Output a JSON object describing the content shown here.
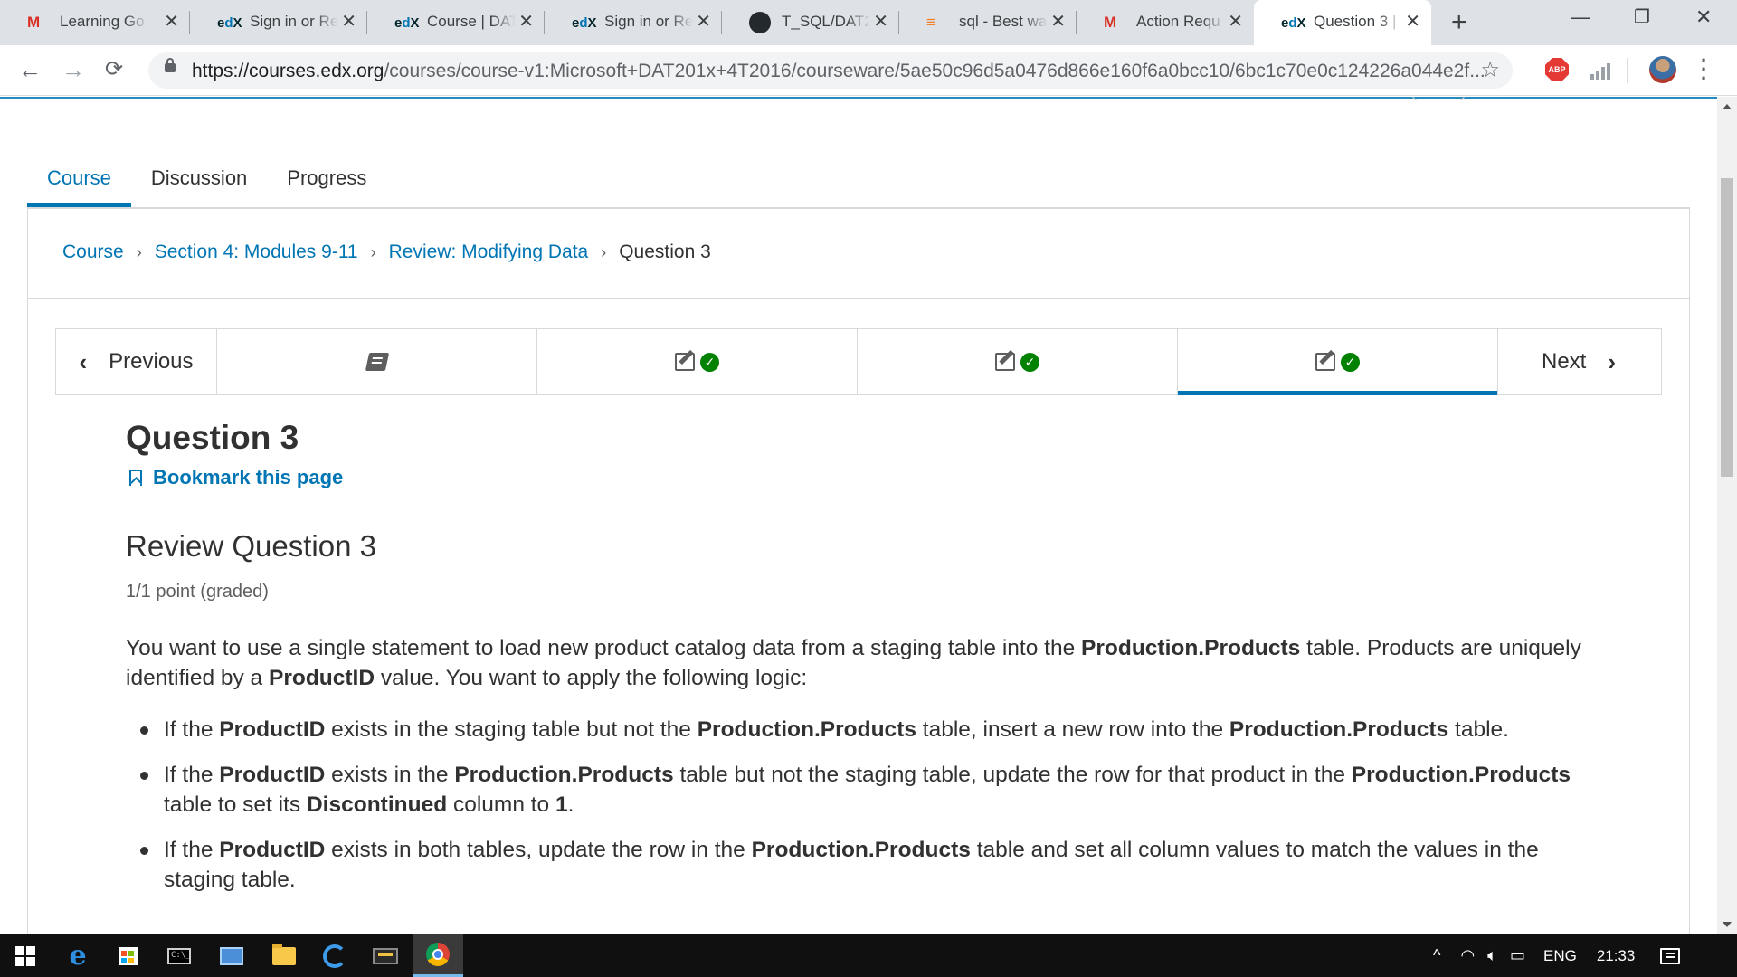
{
  "browser": {
    "tabs": [
      {
        "favicon": "gmail-icon",
        "title": "Learning Go",
        "active": false
      },
      {
        "favicon": "edx-icon",
        "title": "Sign in or Re",
        "active": false
      },
      {
        "favicon": "edx-icon",
        "title": "Course | DAT",
        "active": false
      },
      {
        "favicon": "edx-icon",
        "title": "Sign in or Re",
        "active": false
      },
      {
        "favicon": "github-icon",
        "title": "T_SQL/DAT2",
        "active": false
      },
      {
        "favicon": "stackoverflow-icon",
        "title": "sql - Best wa",
        "active": false
      },
      {
        "favicon": "gmail-icon",
        "title": "Action Requ",
        "active": false
      },
      {
        "favicon": "edx-icon",
        "title": "Question 3 |",
        "active": true
      }
    ],
    "new_tab_glyph": "+",
    "close_glyph": "✕",
    "url_host": "https://courses.edx.org",
    "url_path": "/courses/course-v1:Microsoft+DAT201x+4T2016/courseware/5ae50c96d5a0476d866e160f6a0bcc10/6bc1c70e0c124226a044e2f...",
    "extension_abp_label": "ABP"
  },
  "course_nav": {
    "tabs": [
      "Course",
      "Discussion",
      "Progress"
    ],
    "active_tab": "Course"
  },
  "breadcrumb": {
    "items": [
      "Course",
      "Section 4: Modules 9-11",
      "Review: Modifying Data"
    ],
    "current": "Question 3"
  },
  "sequence_nav": {
    "previous_label": "Previous",
    "next_label": "Next",
    "units": [
      {
        "icon": "book-icon",
        "complete": false,
        "active": false
      },
      {
        "icon": "edit-icon",
        "complete": true,
        "active": false
      },
      {
        "icon": "edit-icon",
        "complete": true,
        "active": false
      },
      {
        "icon": "edit-icon",
        "complete": true,
        "active": true
      }
    ]
  },
  "content": {
    "title": "Question 3",
    "bookmark_label": "Bookmark this page",
    "problem_title": "Review Question 3",
    "points": "1/1 point (graded)",
    "intro_parts": [
      {
        "t": "You want to use a single statement to load new product catalog data from a staging table into the ",
        "b": false
      },
      {
        "t": "Production.Products",
        "b": true
      },
      {
        "t": " table. Products are uniquely identified by a ",
        "b": false
      },
      {
        "t": "ProductID",
        "b": true
      },
      {
        "t": " value. You want to apply the following logic:",
        "b": false
      }
    ],
    "bullets": [
      [
        {
          "t": "If the ",
          "b": false
        },
        {
          "t": "ProductID",
          "b": true
        },
        {
          "t": " exists in the staging table but not the ",
          "b": false
        },
        {
          "t": "Production.Products",
          "b": true
        },
        {
          "t": " table, insert a new row into the ",
          "b": false
        },
        {
          "t": "Production.Products",
          "b": true
        },
        {
          "t": " table.",
          "b": false
        }
      ],
      [
        {
          "t": "If the ",
          "b": false
        },
        {
          "t": "ProductID",
          "b": true
        },
        {
          "t": " exists in the ",
          "b": false
        },
        {
          "t": "Production.Products",
          "b": true
        },
        {
          "t": " table but not the staging table, update the row for that product in the ",
          "b": false
        },
        {
          "t": "Production.Products",
          "b": true
        },
        {
          "t": " table to set its ",
          "b": false
        },
        {
          "t": "Discontinued",
          "b": true
        },
        {
          "t": " column to ",
          "b": false
        },
        {
          "t": "1",
          "b": true
        },
        {
          "t": ".",
          "b": false
        }
      ],
      [
        {
          "t": "If the ",
          "b": false
        },
        {
          "t": "ProductID",
          "b": true
        },
        {
          "t": " exists in both tables, update the row in the ",
          "b": false
        },
        {
          "t": "Production.Products",
          "b": true
        },
        {
          "t": " table and set all column values to match the values in the staging table.",
          "b": false
        }
      ]
    ]
  },
  "taskbar": {
    "language": "ENG",
    "time": "21:33",
    "cmd_label": "C:\\_"
  },
  "colors": {
    "edx_blue": "#0075b4",
    "success_green": "#008100",
    "text_dark": "#313131"
  }
}
